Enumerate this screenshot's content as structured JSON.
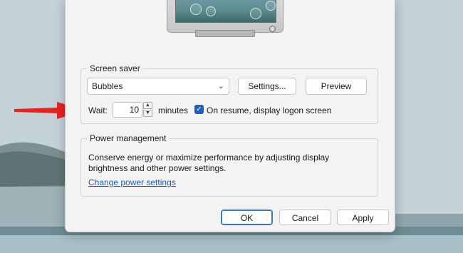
{
  "monitor": {
    "preview": "Bubbles screen saver preview"
  },
  "screen_saver": {
    "group_title": "Screen saver",
    "selected": "Bubbles",
    "settings_label": "Settings...",
    "preview_label": "Preview",
    "wait_label": "Wait:",
    "wait_value": "10",
    "minutes_label": "minutes",
    "resume_label": "On resume, display logon screen",
    "resume_checked": true
  },
  "power": {
    "group_title": "Power management",
    "description_line1": "Conserve energy or maximize performance by adjusting display",
    "description_line2": "brightness and other power settings.",
    "link_label": "Change power settings"
  },
  "footer": {
    "ok_label": "OK",
    "cancel_label": "Cancel",
    "apply_label": "Apply"
  },
  "colors": {
    "arrow": "#e8231f",
    "accent": "#1f5fbf",
    "link": "#1a5fb4"
  },
  "icons": {
    "annotation": "red-arrow-icon",
    "dropdown": "chevron-down-icon",
    "checkbox": "checkmark-icon"
  }
}
